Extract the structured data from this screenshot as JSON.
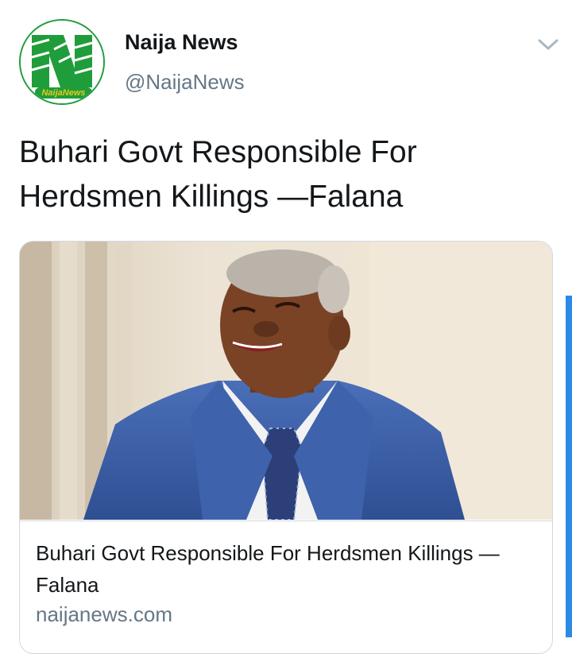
{
  "tweet": {
    "author_name": "Naija News",
    "author_handle": "@NaijaNews",
    "avatar_logo_text": "NaijaNews",
    "text": "Buhari Govt Responsible For Herdsmen Killings —Falana"
  },
  "card": {
    "title": "Buhari Govt Responsible For Herdsmen Killings —Falana",
    "domain": "naijanews.com"
  },
  "icons": {
    "menu": "chevron-down-icon",
    "avatar": "naija-news-logo"
  },
  "colors": {
    "brand_green": "#1f9d3a",
    "handle_gray": "#657786",
    "accent_blue": "#2b8ae6"
  }
}
